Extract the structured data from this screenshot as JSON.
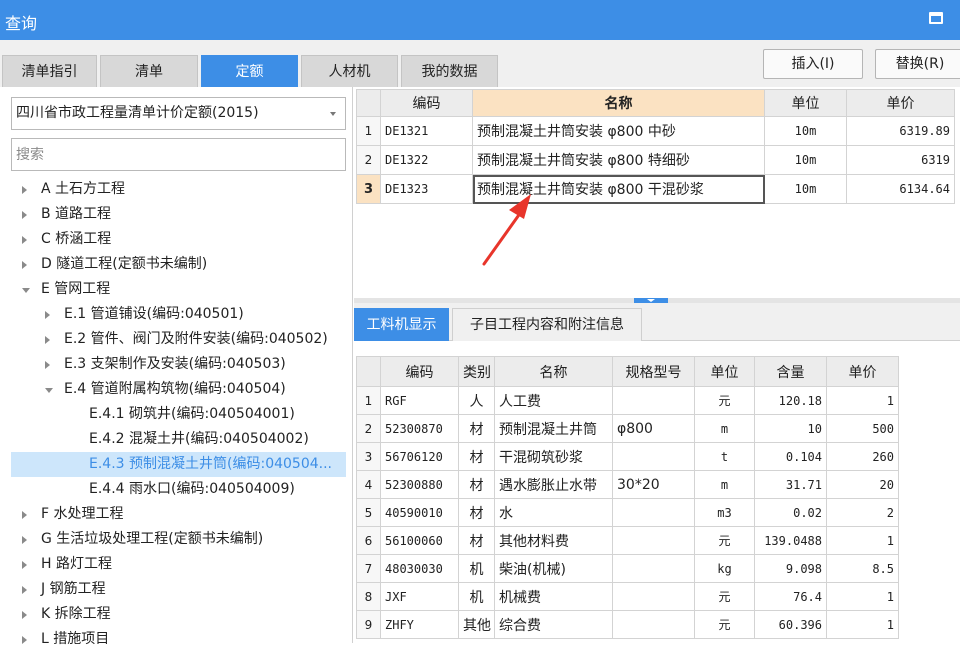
{
  "window": {
    "title": "查询"
  },
  "tabs": [
    {
      "label": "清单指引",
      "active": false
    },
    {
      "label": "清单",
      "active": false
    },
    {
      "label": "定额",
      "active": true
    },
    {
      "label": "人材机",
      "active": false
    },
    {
      "label": "我的数据",
      "active": false
    }
  ],
  "actions": {
    "insert_label": "插入(I)",
    "replace_label": "替换(R)"
  },
  "left": {
    "quota_library": "四川省市政工程量清单计价定额(2015)",
    "search_placeholder": "搜索",
    "tree": [
      {
        "label": "A 土石方工程",
        "state": "collapsed",
        "level": 0
      },
      {
        "label": "B 道路工程",
        "state": "collapsed",
        "level": 0
      },
      {
        "label": "C 桥涵工程",
        "state": "collapsed",
        "level": 0
      },
      {
        "label": "D 隧道工程(定额书未编制)",
        "state": "collapsed",
        "level": 0
      },
      {
        "label": "E 管网工程",
        "state": "expanded",
        "level": 0
      },
      {
        "label": "E.1 管道铺设(编码:040501)",
        "state": "collapsed",
        "level": 1
      },
      {
        "label": "E.2 管件、阀门及附件安装(编码:040502)",
        "state": "collapsed",
        "level": 1
      },
      {
        "label": "E.3 支架制作及安装(编码:040503)",
        "state": "collapsed",
        "level": 1
      },
      {
        "label": "E.4 管道附属构筑物(编码:040504)",
        "state": "expanded",
        "level": 1
      },
      {
        "label": "E.4.1 砌筑井(编码:040504001)",
        "state": "leaf",
        "level": 2
      },
      {
        "label": "E.4.2 混凝土井(编码:040504002)",
        "state": "leaf",
        "level": 2
      },
      {
        "label": "E.4.3 预制混凝土井筒(编码:040504...",
        "state": "leaf",
        "level": 2,
        "selected": true
      },
      {
        "label": "E.4.4 雨水口(编码:040504009)",
        "state": "leaf",
        "level": 2
      },
      {
        "label": "F 水处理工程",
        "state": "collapsed",
        "level": 0
      },
      {
        "label": "G 生活垃圾处理工程(定额书未编制)",
        "state": "collapsed",
        "level": 0
      },
      {
        "label": "H 路灯工程",
        "state": "collapsed",
        "level": 0
      },
      {
        "label": "J 钢筋工程",
        "state": "collapsed",
        "level": 0
      },
      {
        "label": "K 拆除工程",
        "state": "collapsed",
        "level": 0
      },
      {
        "label": "L 措施项目",
        "state": "collapsed",
        "level": 0
      }
    ]
  },
  "quota_table": {
    "headers": {
      "code": "编码",
      "name": "名称",
      "unit": "单位",
      "price": "单价"
    },
    "rows": [
      {
        "idx": "1",
        "code": "DE1321",
        "name": "预制混凝土井筒安装 φ800 中砂",
        "unit": "10m",
        "price": "6319.89"
      },
      {
        "idx": "2",
        "code": "DE1322",
        "name": "预制混凝土井筒安装 φ800 特细砂",
        "unit": "10m",
        "price": "6319"
      },
      {
        "idx": "3",
        "code": "DE1323",
        "name": "预制混凝土井筒安装 φ800 干混砂浆",
        "unit": "10m",
        "price": "6134.64",
        "current": true
      }
    ]
  },
  "subtabs": [
    {
      "label": "工料机显示",
      "active": true
    },
    {
      "label": "子目工程内容和附注信息",
      "active": false
    }
  ],
  "material_table": {
    "headers": {
      "code": "编码",
      "type": "类别",
      "name": "名称",
      "spec": "规格型号",
      "unit": "单位",
      "qty": "含量",
      "price": "单价"
    },
    "rows": [
      {
        "idx": "1",
        "code": "RGF",
        "type": "人",
        "name": "人工费",
        "spec": "",
        "unit": "元",
        "qty": "120.18",
        "price": "1"
      },
      {
        "idx": "2",
        "code": "52300870",
        "type": "材",
        "name": "预制混凝土井筒",
        "spec": "φ800",
        "unit": "m",
        "qty": "10",
        "price": "500"
      },
      {
        "idx": "3",
        "code": "56706120",
        "type": "材",
        "name": "干混砌筑砂浆",
        "spec": "",
        "unit": "t",
        "qty": "0.104",
        "price": "260"
      },
      {
        "idx": "4",
        "code": "52300880",
        "type": "材",
        "name": "遇水膨胀止水带",
        "spec": "30*20",
        "unit": "m",
        "qty": "31.71",
        "price": "20"
      },
      {
        "idx": "5",
        "code": "40590010",
        "type": "材",
        "name": "水",
        "spec": "",
        "unit": "m3",
        "qty": "0.02",
        "price": "2"
      },
      {
        "idx": "6",
        "code": "56100060",
        "type": "材",
        "name": "其他材料费",
        "spec": "",
        "unit": "元",
        "qty": "139.0488",
        "price": "1"
      },
      {
        "idx": "7",
        "code": "48030030",
        "type": "机",
        "name": "柴油(机械)",
        "spec": "",
        "unit": "kg",
        "qty": "9.098",
        "price": "8.5"
      },
      {
        "idx": "8",
        "code": "JXF",
        "type": "机",
        "name": "机械费",
        "spec": "",
        "unit": "元",
        "qty": "76.4",
        "price": "1"
      },
      {
        "idx": "9",
        "code": "ZHFY",
        "type": "其他",
        "name": "综合费",
        "spec": "",
        "unit": "元",
        "qty": "60.396",
        "price": "1"
      }
    ]
  },
  "colors": {
    "accent": "#3d8ee6",
    "header_highlight": "#fbe2c2",
    "arrow": "#e8352b",
    "selection": "#cde6fb"
  }
}
